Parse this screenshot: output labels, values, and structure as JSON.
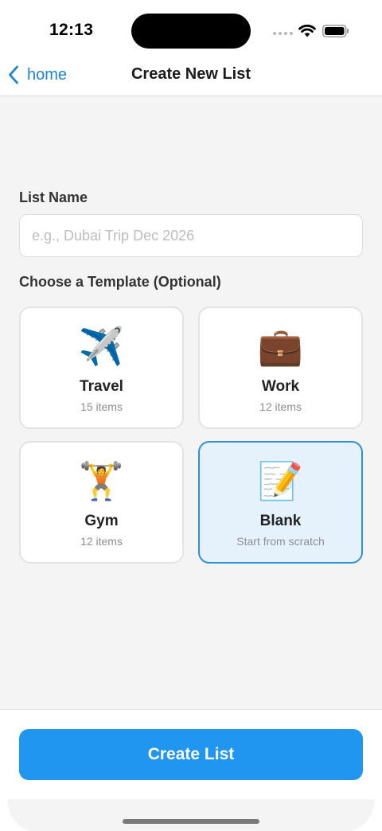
{
  "status_bar": {
    "time": "12:13",
    "icons": [
      "signal-dots-icon",
      "wifi-icon",
      "battery-icon"
    ]
  },
  "nav": {
    "back_label": "home",
    "back_icon": "chevron-left-icon",
    "title": "Create New List"
  },
  "form": {
    "list_name_label": "List Name",
    "list_name_placeholder": "e.g., Dubai Trip Dec 2026",
    "list_name_value": "",
    "template_label": "Choose a Template (Optional)"
  },
  "templates": [
    {
      "icon": "✈️",
      "icon_name": "airplane-icon",
      "title": "Travel",
      "subtitle": "15 items",
      "selected": false
    },
    {
      "icon": "💼",
      "icon_name": "briefcase-icon",
      "title": "Work",
      "subtitle": "12 items",
      "selected": false
    },
    {
      "icon": "🏋️",
      "icon_name": "weightlifter-icon",
      "title": "Gym",
      "subtitle": "12 items",
      "selected": false
    },
    {
      "icon": "📝",
      "icon_name": "memo-icon",
      "title": "Blank",
      "subtitle": "Start from scratch",
      "selected": true
    }
  ],
  "footer": {
    "create_button_label": "Create List"
  },
  "colors": {
    "accent": "#2196f0",
    "link": "#1b83d6",
    "selected_bg": "#e5f2fc",
    "selected_border": "#2f90d8",
    "background": "#f4f4f4"
  }
}
